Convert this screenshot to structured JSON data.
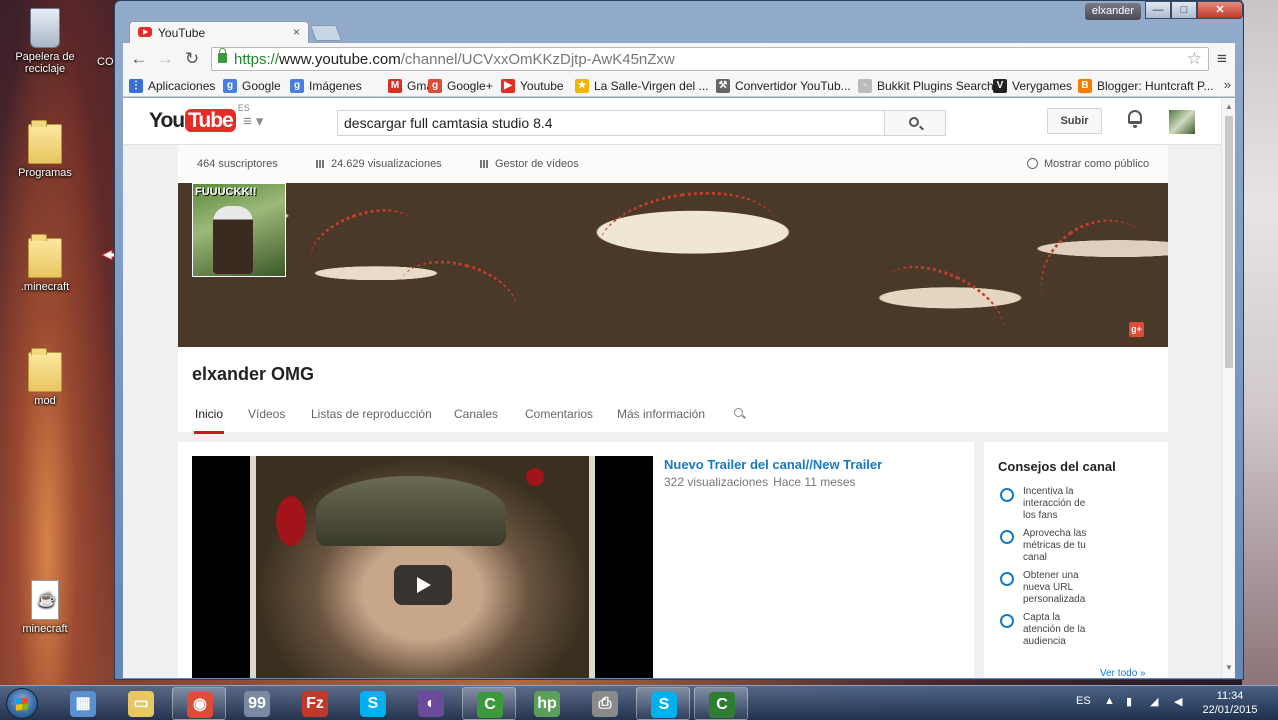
{
  "desktop": {
    "icons": [
      {
        "label": "Papelera de reciclaje",
        "icon": "recycle-bin-icon"
      },
      {
        "label": "Programas",
        "icon": "folder-icon"
      },
      {
        "label": ".minecraft",
        "icon": "folder-icon"
      },
      {
        "label": "mod",
        "icon": "folder-icon"
      },
      {
        "label": "minecraft",
        "icon": "java-file-icon"
      }
    ],
    "partial_label": "CO"
  },
  "window": {
    "user": "elxander",
    "buttons": {
      "minimize": "—",
      "maximize": "□",
      "close": "✕"
    }
  },
  "tab": {
    "title": "YouTube",
    "close": "×",
    "favicon": "youtube-icon"
  },
  "toolbar": {
    "url_scheme": "https://",
    "url_host": "www.youtube.com",
    "url_path": "/channel/UCVxxOmKKzDjtp-AwK45nZxw",
    "back": "←",
    "forward": "→",
    "reload": "↻",
    "star": "☆",
    "menu": "≡"
  },
  "bookmarks": {
    "items": [
      {
        "label": "Aplicaciones",
        "color": "#3b6fd6",
        "glyph": "⋮"
      },
      {
        "label": "Google",
        "color": "#4a7fe0",
        "glyph": "g"
      },
      {
        "label": "Imágenes",
        "color": "#4a7fe0",
        "glyph": "g"
      },
      {
        "label": "Gmail",
        "color": "#d93025",
        "glyph": "M"
      },
      {
        "label": "Google+",
        "color": "#dd4b39",
        "glyph": "g"
      },
      {
        "label": "Youtube",
        "color": "#e52d27",
        "glyph": "▶"
      },
      {
        "label": "La Salle-Virgen del ...",
        "color": "#f4b400",
        "glyph": "★"
      },
      {
        "label": "Convertidor YouTub...",
        "color": "#666666",
        "glyph": "⚒"
      },
      {
        "label": "Bukkit Plugins Search",
        "color": "#bbbbbb",
        "glyph": "▫"
      },
      {
        "label": "Verygames",
        "color": "#222222",
        "glyph": "V"
      },
      {
        "label": "Blogger: Huntcraft P...",
        "color": "#f57d00",
        "glyph": "B"
      }
    ],
    "more": "»"
  },
  "youtube": {
    "logo_you": "You",
    "logo_tube": "Tube",
    "logo_region": "ES",
    "guide": "≡ ▾",
    "search_value": "descargar full camtasia studio 8.4",
    "upload_label": "Subir"
  },
  "channel": {
    "subscribers": "464 suscriptores",
    "views": "24.629 visualizaciones",
    "video_manager": "Gestor de vídeos",
    "view_as_public": "Mostrar como público",
    "avatar_caption": "FUUUCKK!!",
    "gplus": "g+",
    "name": "elxander OMG",
    "tabs": [
      "Inicio",
      "Vídeos",
      "Listas de reproducción",
      "Canales",
      "Comentarios",
      "Más información"
    ],
    "active_tab": "Inicio"
  },
  "featured": {
    "title": "Nuevo Trailer del canal//New Trailer",
    "views": "322 visualizaciones",
    "age": "Hace 11 meses"
  },
  "tips": {
    "title": "Consejos del canal",
    "items": [
      "Incentiva la interacción de los fans",
      "Aprovecha las métricas de tu canal",
      "Obtener una nueva URL personalizada",
      "Capta la atención de la audiencia"
    ],
    "see_all": "Ver todo »"
  },
  "taskbar": {
    "apps": [
      {
        "name": "explorer-icon",
        "color": "#5a8fd0",
        "glyph": "▦",
        "running": false
      },
      {
        "name": "folder-icon",
        "color": "#e8c660",
        "glyph": "▭",
        "running": false
      },
      {
        "name": "chrome-icon",
        "color": "#dd4b39",
        "glyph": "◉",
        "running": true
      },
      {
        "name": "minecraft-launcher-icon",
        "color": "#7a8aa0",
        "glyph": "99",
        "running": false
      },
      {
        "name": "filezilla-icon",
        "color": "#c0392b",
        "glyph": "Fz",
        "running": false
      },
      {
        "name": "skype-icon",
        "color": "#00aff0",
        "glyph": "S",
        "running": false
      },
      {
        "name": "eclipse-icon",
        "color": "#6a4a9a",
        "glyph": "◐",
        "running": false
      },
      {
        "name": "camtasia-icon",
        "color": "#3c9a3c",
        "glyph": "C",
        "running": true
      },
      {
        "name": "hp-icon",
        "color": "#5aa05a",
        "glyph": "hp",
        "running": false
      },
      {
        "name": "printer-icon",
        "color": "#8a8a8a",
        "glyph": "⎙",
        "running": false
      },
      {
        "name": "skype-icon",
        "color": "#00aff0",
        "glyph": "S",
        "running": true
      },
      {
        "name": "camtasia-recorder-icon",
        "color": "#2e7d32",
        "glyph": "C",
        "running": true
      }
    ],
    "language": "ES",
    "time": "11:34",
    "date": "22/01/2015"
  }
}
